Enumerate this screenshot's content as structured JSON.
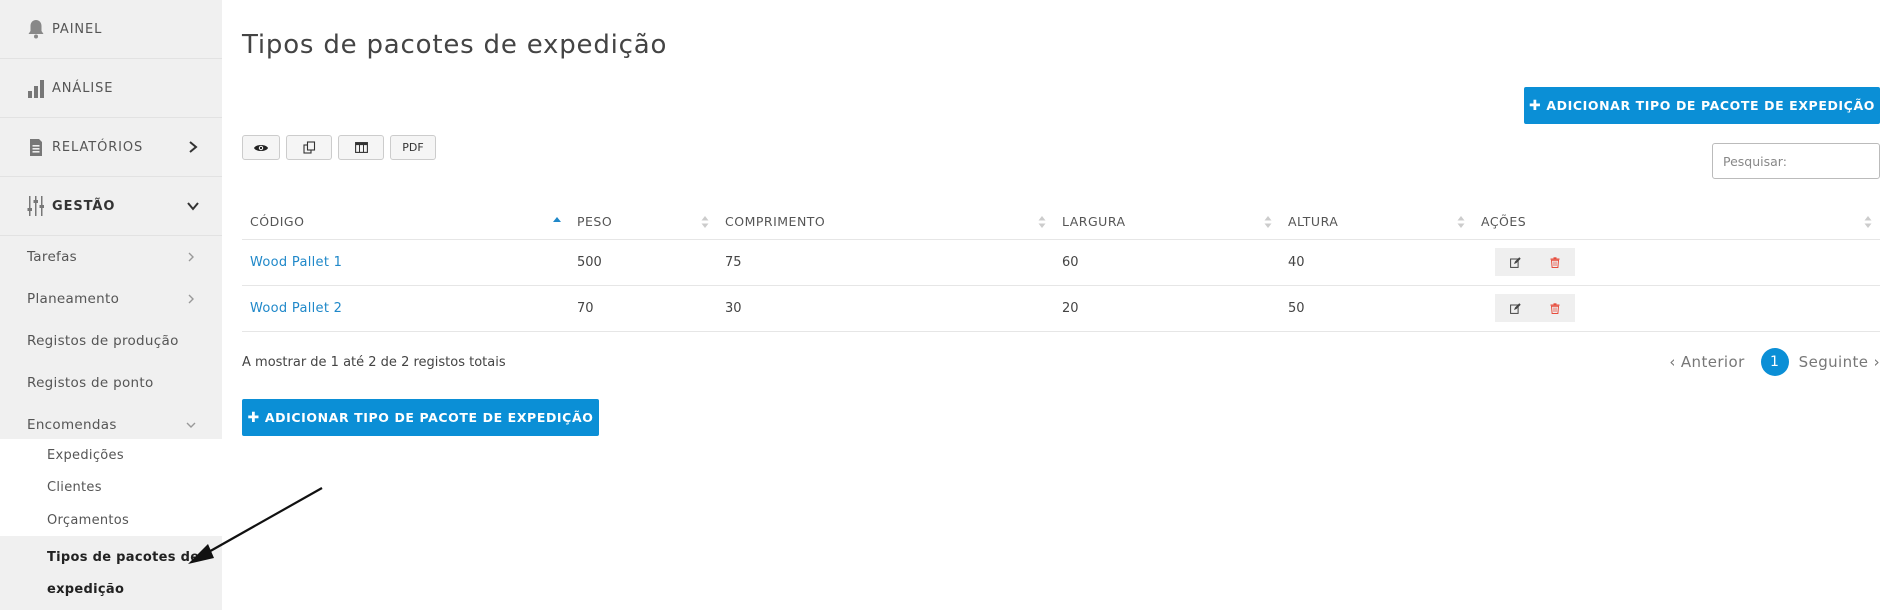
{
  "sidebar": {
    "top": [
      {
        "label": "PAINEL",
        "icon": "bell-icon"
      },
      {
        "label": "ANÁLISE",
        "icon": "bar-chart-icon"
      },
      {
        "label": "RELATÓRIOS",
        "icon": "document-icon"
      },
      {
        "label": "GESTÃO",
        "icon": "sliders-icon"
      }
    ],
    "sub": [
      {
        "label": "Tarefas"
      },
      {
        "label": "Planeamento"
      },
      {
        "label": "Registos de produção"
      },
      {
        "label": "Registos de ponto"
      },
      {
        "label": "Encomendas"
      }
    ],
    "subsub": [
      {
        "label": "Expedições"
      },
      {
        "label": "Clientes"
      },
      {
        "label": "Orçamentos"
      }
    ],
    "active_line1": "Tipos de pacotes de",
    "active_line2": "expedição"
  },
  "main": {
    "title": "Tipos de pacotes de expedição",
    "add_button_label": "ADICIONAR TIPO DE PACOTE DE EXPEDIÇÃO",
    "toolbar": {
      "view_icon": "eye-icon",
      "copy_icon": "copy-icon",
      "columns_icon": "columns-icon",
      "pdf_label": "PDF"
    },
    "search": {
      "placeholder": "Pesquisar:"
    },
    "table": {
      "headers": [
        "CÓDIGO",
        "PESO",
        "COMPRIMENTO",
        "LARGURA",
        "ALTURA",
        "AÇÕES"
      ],
      "rows": [
        {
          "code": "Wood Pallet 1",
          "weight": "500",
          "length": "75",
          "width": "60",
          "height": "40"
        },
        {
          "code": "Wood Pallet 2",
          "weight": "70",
          "length": "30",
          "width": "20",
          "height": "50"
        }
      ]
    },
    "info": "A mostrar de 1 até 2 de 2 registos totais",
    "pagination": {
      "previous": "Anterior",
      "current": "1",
      "next": "Seguinte"
    }
  },
  "colors": {
    "accent": "#0b8fd6",
    "link": "#1f88c9",
    "sidebar_bg": "#f0f0f0",
    "delete": "#e74c3c"
  }
}
